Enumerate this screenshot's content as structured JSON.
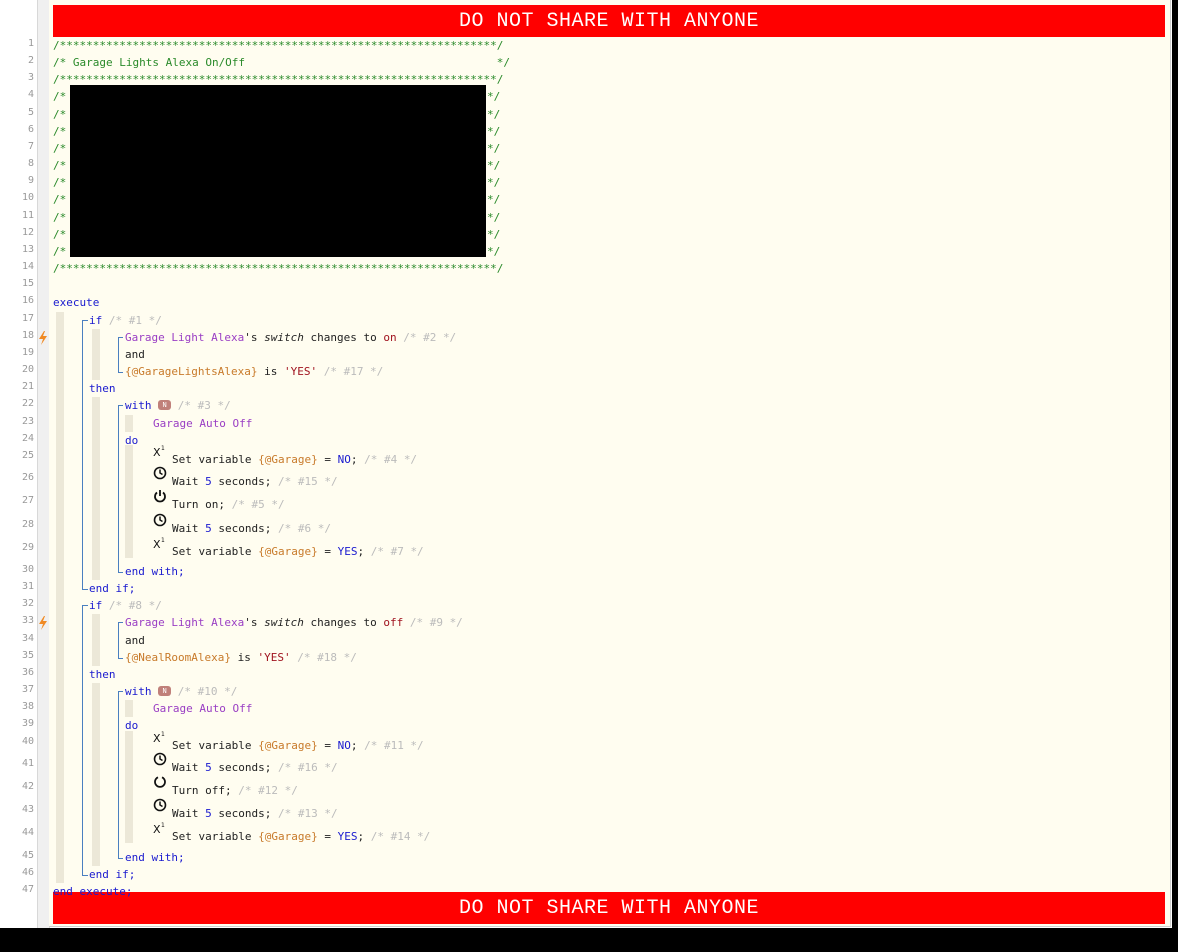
{
  "banner_top": "DO NOT SHARE WITH ANYONE",
  "banner_bottom": "DO NOT SHARE WITH ANYONE",
  "line_numbers": [
    "1",
    "2",
    "3",
    "4",
    "5",
    "6",
    "7",
    "8",
    "9",
    "10",
    "11",
    "12",
    "13",
    "14",
    "15",
    "16",
    "17",
    "18",
    "19",
    "20",
    "21",
    "22",
    "23",
    "24",
    "25",
    "26",
    "27",
    "28",
    "29",
    "30",
    "31",
    "32",
    "33",
    "34",
    "35",
    "36",
    "37",
    "38",
    "39",
    "40",
    "41",
    "42",
    "43",
    "44",
    "45",
    "46",
    "47"
  ],
  "header": {
    "stars_line": "/******************************************************************/",
    "title_line": "/* Garage Lights Alexa On/Off                                      */",
    "comment_open": "/*",
    "comment_close": "*/"
  },
  "code": {
    "execute": "execute",
    "end_execute": "end execute;",
    "blocks": [
      {
        "if": "if",
        "if_id": "/* #1 */",
        "cond1_device": "Garage Light Alexa",
        "cond1_attr_pre": "'s ",
        "cond1_attr": "switch",
        "cond1_mid": " changes to ",
        "cond1_value": "on",
        "cond1_id": "/* #2 */",
        "and": "and",
        "cond2_var": "{@GarageLightsAlexa}",
        "cond2_mid": " is ",
        "cond2_value": "'YES'",
        "cond2_id": "/* #17 */",
        "then": "then",
        "with": "with",
        "with_badge": "N",
        "with_id": "/* #3 */",
        "with_device": "Garage Auto Off",
        "do": "do",
        "actions": [
          {
            "icon": "variable-icon",
            "pre": "Set variable ",
            "var": "{@Garage}",
            "mid": " = ",
            "val": "NO",
            "post": ";",
            "id": "/* #4 */"
          },
          {
            "icon": "clock-icon",
            "pre": "Wait ",
            "num": "5",
            "post": " seconds;",
            "id": "/* #15 */"
          },
          {
            "icon": "power-icon",
            "pre": "Turn on;",
            "id": "/* #5 */"
          },
          {
            "icon": "clock-icon",
            "pre": "Wait ",
            "num": "5",
            "post": " seconds;",
            "id": "/* #6 */"
          },
          {
            "icon": "variable-icon",
            "pre": "Set variable ",
            "var": "{@Garage}",
            "mid": " = ",
            "val": "YES",
            "post": ";",
            "id": "/* #7 */"
          }
        ],
        "end_with": "end with;",
        "end_if": "end if;"
      },
      {
        "if": "if",
        "if_id": "/* #8 */",
        "cond1_device": "Garage Light Alexa",
        "cond1_attr_pre": "'s ",
        "cond1_attr": "switch",
        "cond1_mid": " changes to ",
        "cond1_value": "off",
        "cond1_id": "/* #9 */",
        "and": "and",
        "cond2_var": "{@NealRoomAlexa}",
        "cond2_mid": " is ",
        "cond2_value": "'YES'",
        "cond2_id": "/* #18 */",
        "then": "then",
        "with": "with",
        "with_badge": "N",
        "with_id": "/* #10 */",
        "with_device": "Garage Auto Off",
        "do": "do",
        "actions": [
          {
            "icon": "variable-icon",
            "pre": "Set variable ",
            "var": "{@Garage}",
            "mid": " = ",
            "val": "NO",
            "post": ";",
            "id": "/* #11 */"
          },
          {
            "icon": "clock-icon",
            "pre": "Wait ",
            "num": "5",
            "post": " seconds;",
            "id": "/* #16 */"
          },
          {
            "icon": "power-off-icon",
            "pre": "Turn off;",
            "id": "/* #12 */"
          },
          {
            "icon": "clock-icon",
            "pre": "Wait ",
            "num": "5",
            "post": " seconds;",
            "id": "/* #13 */"
          },
          {
            "icon": "variable-icon",
            "pre": "Set variable ",
            "var": "{@Garage}",
            "mid": " = ",
            "val": "YES",
            "post": ";",
            "id": "/* #14 */"
          }
        ],
        "end_with": "end with;",
        "end_if": "end if;"
      }
    ]
  },
  "colors": {
    "banner": "#ff0000",
    "keyword": "#1a1acf",
    "device": "#9a3ec4",
    "variable": "#c87a2a",
    "string": "#a0121e",
    "comment": "#2a8a2a",
    "trigger": "#f08a24"
  }
}
